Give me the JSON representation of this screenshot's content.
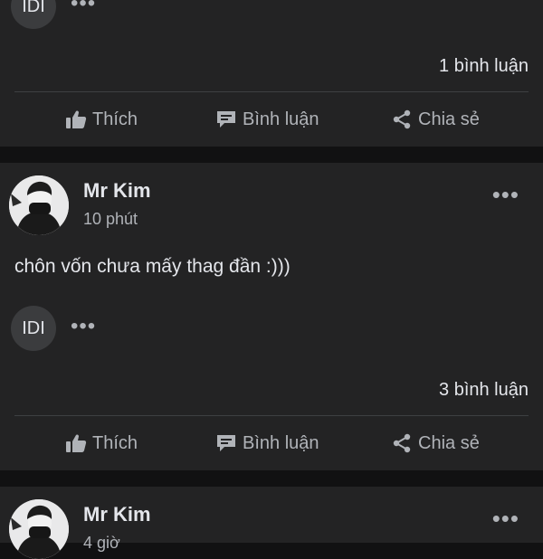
{
  "posts": [
    {
      "reply_badge": "IDI",
      "comment_count": "1 bình luận"
    },
    {
      "author": "Mr Kim",
      "time": "10 phút",
      "text": "chôn vốn chưa mấy thag đần :)))",
      "reply_badge": "IDI",
      "comment_count": "3 bình luận"
    },
    {
      "author": "Mr Kim",
      "time": "4 giờ"
    }
  ],
  "actions": {
    "like": "Thích",
    "comment": "Bình luận",
    "share": "Chia sẻ"
  },
  "icons": [
    "thumbs-up-icon",
    "comment-icon",
    "share-icon",
    "more-dots-icon"
  ],
  "colors": {
    "background": "#111112",
    "card": "#232324",
    "text": "#e4e6eb",
    "muted": "#b0b3b8"
  }
}
